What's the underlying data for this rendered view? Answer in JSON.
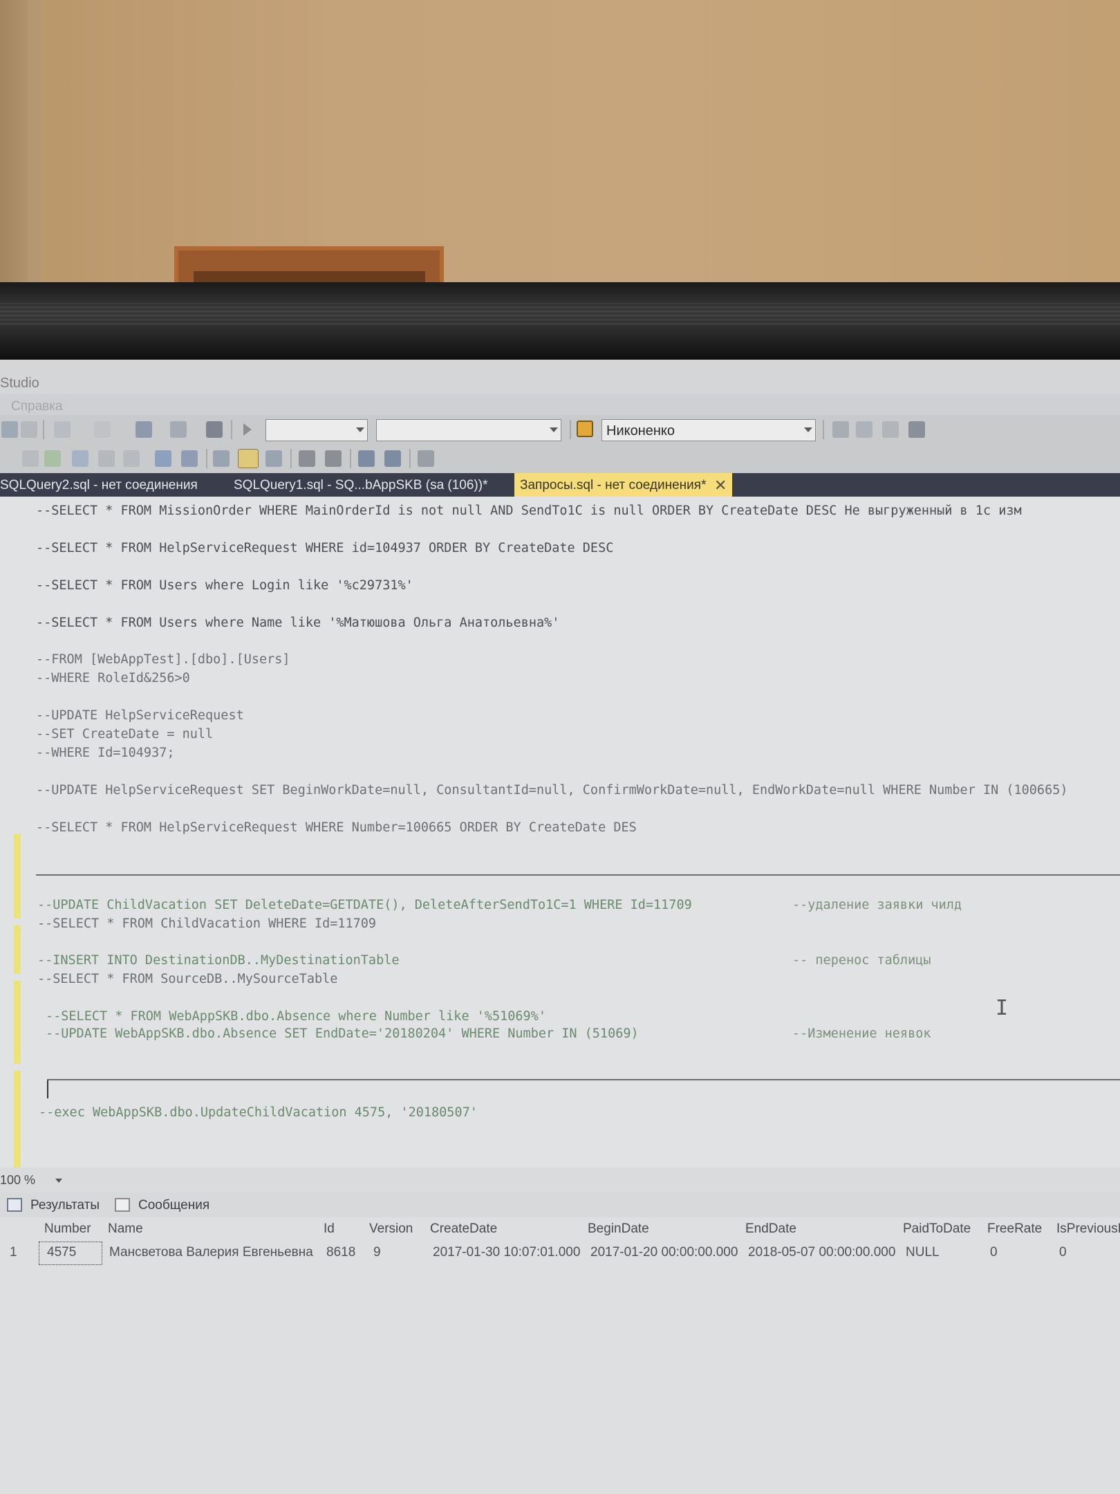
{
  "window": {
    "title": "Studio"
  },
  "menu": {
    "help": "Справка"
  },
  "toolbar": {
    "user_combo": "Никоненко"
  },
  "tabs": [
    {
      "label": "SQLQuery2.sql - нет соединения"
    },
    {
      "label": "SQLQuery1.sql - SQ...bAppSKB (sa (106))*"
    },
    {
      "label": "Запросы.sql - нет соединения*"
    }
  ],
  "editor": {
    "lines": [
      "--SELECT * FROM MissionOrder WHERE MainOrderId is not null AND SendTo1C is null ORDER BY CreateDate DESC Не выгруженный в 1с изм",
      "--SELECT * FROM HelpServiceRequest WHERE id=104937 ORDER BY CreateDate DESC",
      "--SELECT * FROM Users where Login like '%c29731%'",
      "--SELECT * FROM Users where Name like '%Матюшова Ольга Анатольевна%'",
      "--FROM [WebAppTest].[dbo].[Users]",
      "--WHERE RoleId&256>0",
      "--UPDATE HelpServiceRequest",
      "--SET CreateDate = null",
      "--WHERE Id=104937;",
      "--UPDATE HelpServiceRequest SET BeginWorkDate=null, ConsultantId=null, ConfirmWorkDate=null, EndWorkDate=null WHERE Number IN (100665)",
      "--SELECT * FROM HelpServiceRequest WHERE Number=100665 ORDER BY CreateDate DES",
      "--UPDATE ChildVacation SET DeleteDate=GETDATE(), DeleteAfterSendTo1C=1 WHERE Id=11709",
      "--удаление заявки чилд",
      "--SELECT * FROM ChildVacation WHERE Id=11709",
      "--INSERT INTO DestinationDB..MyDestinationTable",
      "-- перенос таблицы",
      "--SELECT * FROM SourceDB..MySourceTable",
      "--SELECT * FROM WebAppSKB.dbo.Absence where Number like '%51069%'",
      "--UPDATE WebAppSKB.dbo.Absence SET EndDate='20180204' WHERE Number IN (51069)",
      "--Изменение неявок",
      "--exec WebAppSKB.dbo.UpdateChildVacation 4575, '20180507'"
    ]
  },
  "zoom": {
    "level": "100 %"
  },
  "results": {
    "tabs": [
      "Результаты",
      "Сообщения"
    ],
    "columns": [
      "Number",
      "Name",
      "Id",
      "Version",
      "CreateDate",
      "BeginDate",
      "EndDate",
      "PaidToDate",
      "FreeRate",
      "IsPreviousP"
    ],
    "rows": [
      {
        "row_no": "1",
        "cells": [
          "4575",
          "Мансветова Валерия Евгеньевна",
          "8618",
          "9",
          "2017-01-30 10:07:01.000",
          "2017-01-20 00:00:00.000",
          "2018-05-07 00:00:00.000",
          "NULL",
          "0",
          "0"
        ]
      }
    ]
  },
  "icons": [
    "undo-icon",
    "redo-icon",
    "execute-icon",
    "parse-icon",
    "comment-icon",
    "uncomment-icon",
    "indent-icon",
    "outdent-icon"
  ],
  "colors": {
    "active_tab": "#f4dd7a",
    "tabstrip": "#3a3d4b",
    "comment_green": "#6a8a6d",
    "change_marker": "#ece27a"
  }
}
